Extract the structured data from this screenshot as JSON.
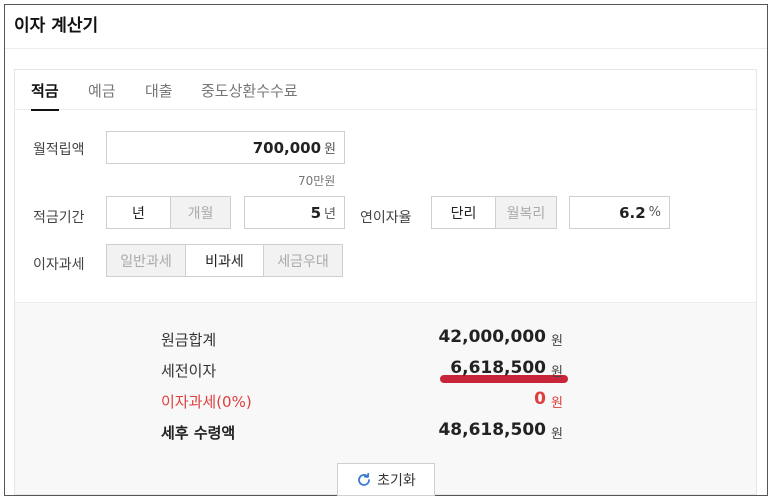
{
  "app": {
    "title": "이자 계산기"
  },
  "tabs": [
    {
      "label": "적금",
      "active": true
    },
    {
      "label": "예금",
      "active": false
    },
    {
      "label": "대출",
      "active": false
    },
    {
      "label": "중도상환수수료",
      "active": false
    }
  ],
  "form": {
    "monthly_label": "월적립액",
    "monthly_value": "700,000",
    "monthly_unit": "원",
    "monthly_hint": "70만원",
    "period_label": "적금기간",
    "period_options": [
      "년",
      "개월"
    ],
    "period_selected": "년",
    "period_value": "5",
    "period_unit": "년",
    "rate_label": "연이자율",
    "rate_options": [
      "단리",
      "월복리"
    ],
    "rate_selected": "단리",
    "rate_value": "6.2",
    "rate_unit": "%",
    "tax_label": "이자과세",
    "tax_options": [
      "일반과세",
      "비과세",
      "세금우대"
    ],
    "tax_selected": "비과세"
  },
  "results": {
    "principal_label": "원금합계",
    "principal_value": "42,000,000",
    "pretax_label": "세전이자",
    "pretax_value": "6,618,500",
    "tax_label": "이자과세(0%)",
    "tax_value": "0",
    "net_label": "세후 수령액",
    "net_value": "48,618,500",
    "unit": "원"
  },
  "reset": {
    "label": "초기화",
    "icon": "refresh-icon"
  },
  "colors": {
    "accent_red": "#e03e3e",
    "underline": "#c8243a"
  }
}
